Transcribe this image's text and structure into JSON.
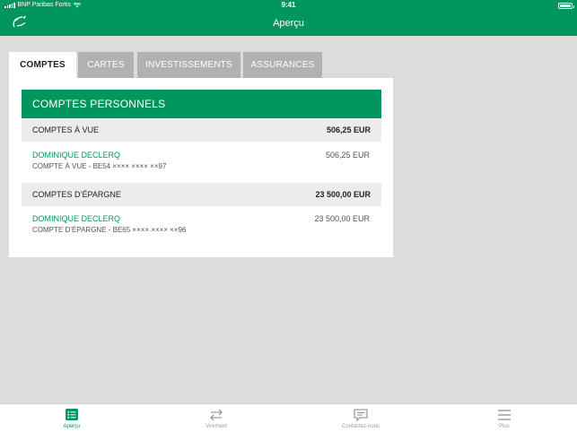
{
  "status": {
    "carrier": "BNP Paribas Fortis",
    "time": "9:41"
  },
  "header": {
    "title": "Aperçu"
  },
  "tabs": [
    "COMPTES",
    "CARTES",
    "INVESTISSEMENTS",
    "ASSURANCES"
  ],
  "section": {
    "title": "COMPTES PERSONNELS"
  },
  "groups": [
    {
      "label": "COMPTES À VUE",
      "total": "506,25 EUR",
      "account": {
        "holder": "DOMINIQUE DECLERQ",
        "iban": "COMPTE À VUE - BE54 ×××× ×××× ××97",
        "balance": "506,25 EUR"
      }
    },
    {
      "label": "COMPTES D’ÉPARGNE",
      "total": "23 500,00 EUR",
      "account": {
        "holder": "DOMINIQUE DECLERQ",
        "iban": "COMPTE D’ÉPARGNE - BE65 ×××× ×××× ××96",
        "balance": "23 500,00 EUR"
      }
    }
  ],
  "bottom_nav": [
    "Aperçu",
    "Virement",
    "Contactez-nous",
    "Plus"
  ],
  "colors": {
    "brand": "#00965e",
    "tab_inactive": "#b1b1b1",
    "background": "#dcdcdc"
  }
}
